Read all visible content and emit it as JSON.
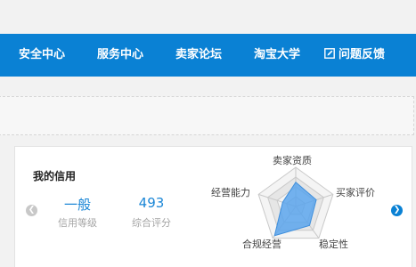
{
  "nav": {
    "items": [
      {
        "label": "安全中心"
      },
      {
        "label": "服务中心"
      },
      {
        "label": "卖家论坛"
      },
      {
        "label": "淘宝大学"
      },
      {
        "label": "问题反馈",
        "icon": "edit-icon"
      }
    ]
  },
  "credit": {
    "title": "我的信用",
    "level_value": "一般",
    "level_label": "信用等级",
    "score_value": "493",
    "score_label": "综合评分",
    "radar": {
      "dimensions": [
        "卖家资质",
        "买家评价",
        "稳定性",
        "合规经营",
        "经营能力"
      ],
      "levels": [
        0.62,
        0.55,
        0.6,
        0.92,
        0.35
      ],
      "fill_color": "#5aa5ec",
      "grid_color": "#c9c9c9"
    }
  },
  "colors": {
    "nav_bg": "#0a81d4",
    "accent": "#1a86d6"
  }
}
